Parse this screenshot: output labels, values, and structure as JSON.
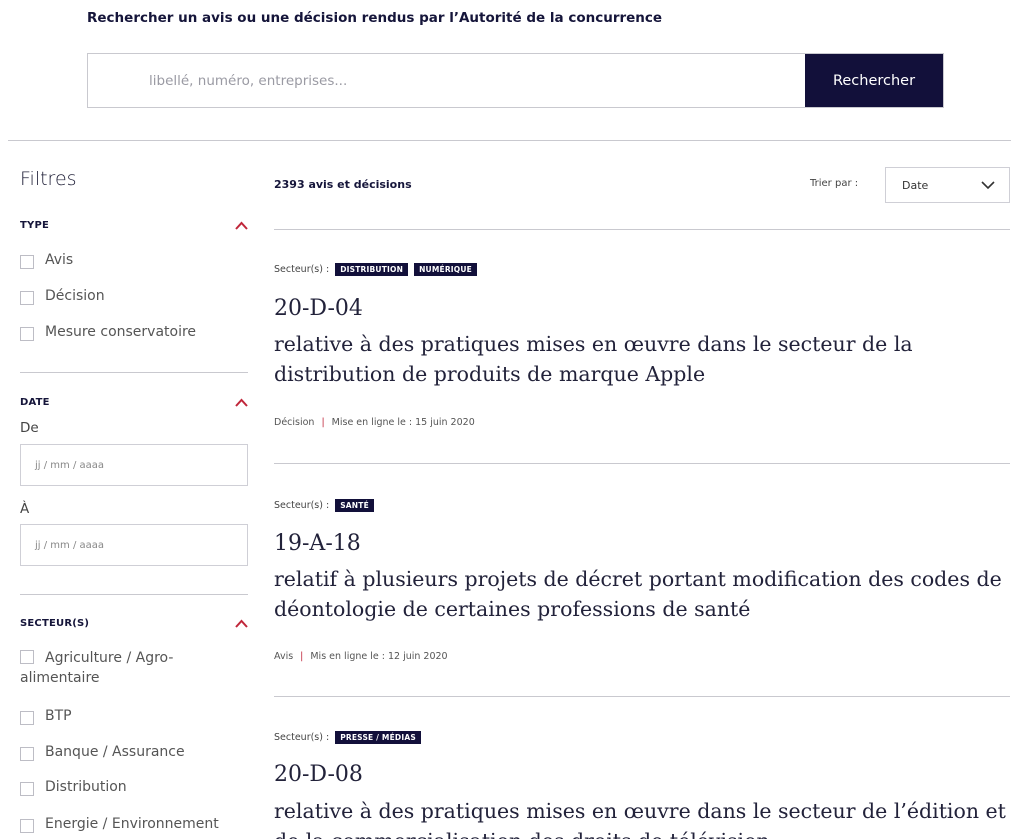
{
  "search": {
    "title": "Rechercher un avis ou une décision rendus par l’Autorité de la concurrence",
    "placeholder": "libellé, numéro, entreprises...",
    "button": "Rechercher"
  },
  "sidebar": {
    "title": "Filtres",
    "type": {
      "label": "TYPE",
      "options": [
        "Avis",
        "Décision",
        "Mesure conservatoire"
      ]
    },
    "date": {
      "label": "DATE",
      "from_label": "De",
      "from_placeholder": "jj / mm / aaaa",
      "to_label": "À",
      "to_placeholder": "jj / mm / aaaa"
    },
    "sectors": {
      "label": "SECTEUR(S)",
      "options": [
        "Agriculture / Agro-alimentaire",
        "BTP",
        "Banque / Assurance",
        "Distribution",
        "Energie / Environnement"
      ]
    }
  },
  "results": {
    "count": "2393 avis et décisions",
    "sort_label": "Trier par :",
    "sort_value": "Date",
    "sectors_label": "Secteur(s) :",
    "items": [
      {
        "badges": [
          "DISTRIBUTION",
          "NUMÉRIQUE"
        ],
        "code": "20-D-04",
        "title": "relative à des pratiques mises en œuvre dans le secteur de la distribution de produits de marque Apple",
        "type": "Décision",
        "date": "Mise en ligne le : 15 juin 2020"
      },
      {
        "badges": [
          "SANTÉ"
        ],
        "code": "19-A-18",
        "title": "relatif à plusieurs projets de décret portant modification des codes de déontologie de certaines professions de santé",
        "type": "Avis",
        "date": "Mis en ligne le : 12 juin 2020"
      },
      {
        "badges": [
          "PRESSE / MÉDIAS"
        ],
        "code": "20-D-08",
        "title": "relative à des pratiques mises en œuvre dans le secteur de l’édition et de la commercialisation des droits de télévision"
      }
    ]
  },
  "colors": {
    "navy": "#12103a",
    "accent": "#c0263a"
  }
}
